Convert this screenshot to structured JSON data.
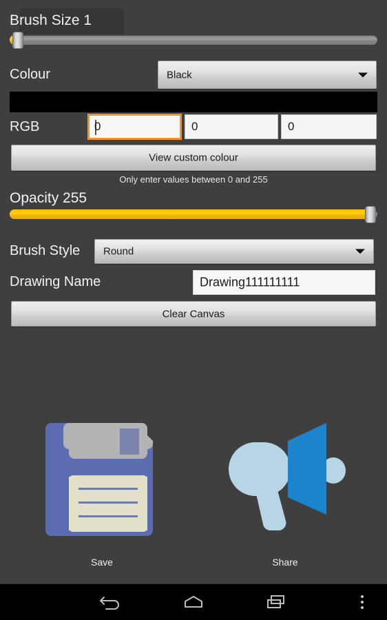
{
  "app": {
    "background_color": "#3f3f3f",
    "accent_color": "#ffc400",
    "focus_color": "#f79421"
  },
  "brush_size": {
    "label": "Brush Size 1",
    "value": 1,
    "min": 1,
    "max": 100,
    "percent": 0
  },
  "colour": {
    "label": "Colour",
    "selected": "Black",
    "preview_hex": "#000000"
  },
  "rgb": {
    "label": "RGB",
    "red": "0",
    "green": "0",
    "blue": "0",
    "hint": "Only enter values between 0 and 255"
  },
  "custom_colour_button": {
    "label": "View custom colour"
  },
  "opacity": {
    "label": "Opacity 255",
    "value": 255,
    "min": 0,
    "max": 255,
    "percent": 100
  },
  "brush_style": {
    "label": "Brush Style",
    "selected": "Round"
  },
  "drawing_name": {
    "label": "Drawing Name",
    "value": "Drawing111111111"
  },
  "clear_canvas_button": {
    "label": "Clear Canvas"
  },
  "actions": {
    "save": {
      "label": "Save",
      "icon": "floppy-disk-icon",
      "colors": {
        "body": "#5c6cb0",
        "shutter": "#b3b3b3",
        "shutter_slot": "#7b84ac",
        "label": "#e2e0c8",
        "lines": "#6f7aa4"
      }
    },
    "share": {
      "label": "Share",
      "icon": "megaphone-icon",
      "colors": {
        "body": "#b7d5e4",
        "horn": "#1b84cd"
      }
    }
  },
  "navbar": {
    "back": "back-icon",
    "home": "home-icon",
    "recents": "recents-icon",
    "overflow": "overflow-menu-icon"
  }
}
